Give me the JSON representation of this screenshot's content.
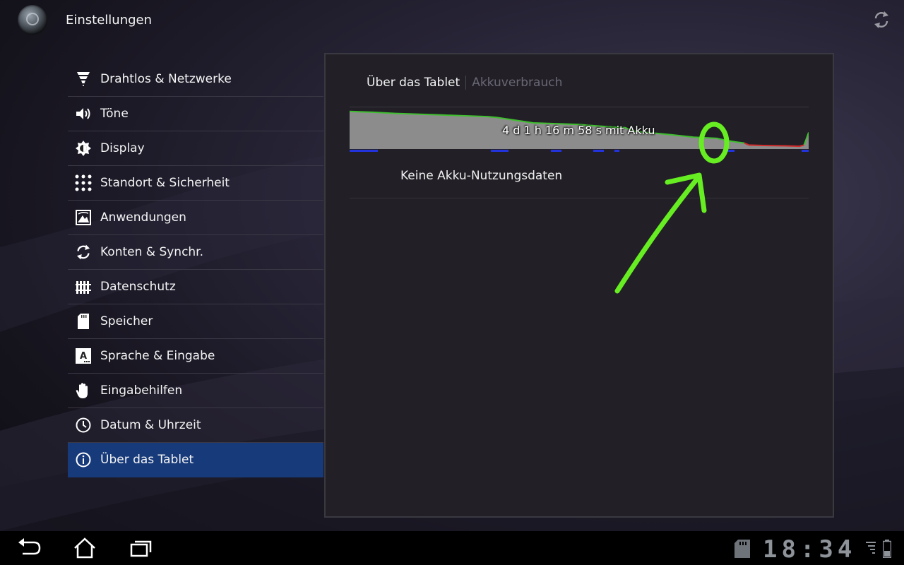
{
  "header": {
    "title": "Einstellungen",
    "app_icon": "settings-app-icon",
    "refresh_icon": "sync-icon"
  },
  "menu": [
    {
      "label": "Drahtlos & Netzwerke",
      "icon": "wireless-icon"
    },
    {
      "label": "Töne",
      "icon": "speaker-icon"
    },
    {
      "label": "Display",
      "icon": "brightness-icon"
    },
    {
      "label": "Standort & Sicherheit",
      "icon": "location-grid-icon"
    },
    {
      "label": "Anwendungen",
      "icon": "apps-icon"
    },
    {
      "label": "Konten & Synchr.",
      "icon": "sync-icon"
    },
    {
      "label": "Datenschutz",
      "icon": "privacy-fence-icon"
    },
    {
      "label": "Speicher",
      "icon": "sd-card-icon"
    },
    {
      "label": "Sprache & Eingabe",
      "icon": "language-icon"
    },
    {
      "label": "Eingabehilfen",
      "icon": "hand-icon"
    },
    {
      "label": "Datum & Uhrzeit",
      "icon": "clock-icon"
    },
    {
      "label": "Über das Tablet",
      "icon": "info-icon",
      "selected": true
    }
  ],
  "panel": {
    "breadcrumb_active": "Über das Tablet",
    "breadcrumb_inactive": "Akkuverbrauch",
    "battery_duration": "4 d 1 h 16 m 58 s mit Akku",
    "empty_message": "Keine Akku-Nutzungsdaten"
  },
  "chart_data": {
    "type": "area",
    "x": [
      0,
      0.05,
      0.1,
      0.2,
      0.3,
      0.32,
      0.4,
      0.5,
      0.52,
      0.58,
      0.6,
      0.62,
      0.7,
      0.75,
      0.8,
      0.82,
      0.84,
      0.86,
      0.87,
      0.9,
      0.95,
      0.98,
      0.99,
      1.0
    ],
    "y": [
      95,
      93,
      90,
      86,
      82,
      80,
      66,
      62,
      60,
      55,
      54,
      45,
      36,
      30,
      27,
      22,
      18,
      15,
      10,
      9,
      8,
      7,
      10,
      42
    ],
    "ylim": [
      0,
      100
    ],
    "low_threshold_index": 17,
    "colors": {
      "fill": "#8c8c8c",
      "normal_line": "#3fbf2f",
      "low_line": "#d22a2a",
      "charging_marks": "#2233dd"
    }
  },
  "annotation_color": "#66ee22",
  "system_bar": {
    "clock": "18:34",
    "icons": [
      "back-icon",
      "home-icon",
      "recent-apps-icon",
      "sd-card-icon",
      "signal-icon",
      "battery-icon"
    ]
  }
}
